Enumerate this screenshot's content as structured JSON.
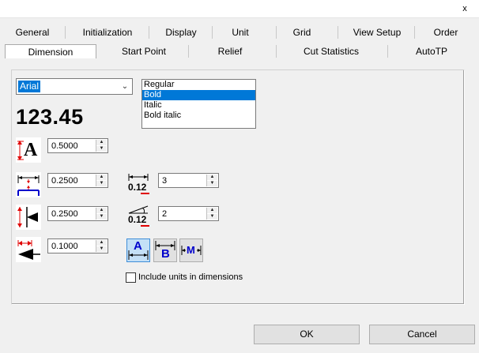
{
  "titlebar": {
    "close_glyph": "x"
  },
  "tabs_row1": [
    "General",
    "Initialization",
    "Display",
    "Unit",
    "Grid",
    "View Setup",
    "Order"
  ],
  "tabs_row2": [
    "Dimension",
    "Start Point",
    "Relief",
    "Cut Statistics",
    "AutoTP"
  ],
  "active_tab": "Dimension",
  "font": {
    "family_value": "Arial",
    "styles": [
      "Regular",
      "Bold",
      "Italic",
      "Bold italic"
    ],
    "selected_style": "Bold",
    "preview_text": "123.45"
  },
  "fields": {
    "text_height": "0.5000",
    "extension_gap": "0.2500",
    "arrow_gap": "0.2500",
    "arrow_size": "0.1000",
    "decimal_places": "3",
    "angle_decimal_places": "2"
  },
  "icons": {
    "dec_label": "0.12",
    "text_a": "A",
    "btn_a": "A",
    "btn_b": "B",
    "btn_m": "M"
  },
  "checkbox": {
    "label": "Include units in dimensions",
    "checked": false
  },
  "buttons": {
    "ok": "OK",
    "cancel": "Cancel"
  },
  "colors": {
    "accent": "#0078d7",
    "icon_red": "#e00000",
    "icon_blue": "#0000cc"
  }
}
